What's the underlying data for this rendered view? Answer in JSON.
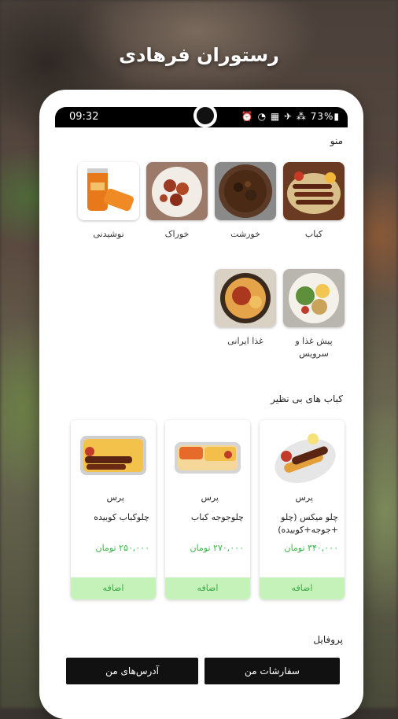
{
  "app": {
    "title": "رستوران فرهادی"
  },
  "status_bar": {
    "time": "09:32",
    "battery": "73%",
    "icons": "⏰ ◔ ▦ ✈ ⁂ 73%▮"
  },
  "menu": {
    "title": "منو",
    "categories": [
      {
        "label": "کباب",
        "icon": "kebab-photo"
      },
      {
        "label": "خورشت",
        "icon": "stew-photo"
      },
      {
        "label": "خوراک",
        "icon": "dish-photo"
      },
      {
        "label": "نوشیدنی",
        "icon": "drink-photo"
      },
      {
        "label": "پیش غذا و سرویس",
        "icon": "appetizer-photo"
      },
      {
        "label": "غذا ایرانی",
        "icon": "iranian-food-photo"
      }
    ]
  },
  "featured": {
    "title": "کباب های بی نظیر",
    "items": [
      {
        "size": "پرس",
        "name": "چلو میکس (چلو +جوجه+کوبیده)",
        "price": "۳۴۰,۰۰۰ تومان",
        "add_label": "اضافه"
      },
      {
        "size": "پرس",
        "name": "چلوجوجه کباب",
        "price": "۲۷۰,۰۰۰ تومان",
        "add_label": "اضافه"
      },
      {
        "size": "پرس",
        "name": "چلوکباب کوبیده",
        "price": "۲۵۰,۰۰۰ تومان",
        "add_label": "اضافه"
      }
    ]
  },
  "profile": {
    "title": "پروفایل",
    "orders_label": "سفارشات من",
    "addresses_label": "آدرس‌های من"
  }
}
